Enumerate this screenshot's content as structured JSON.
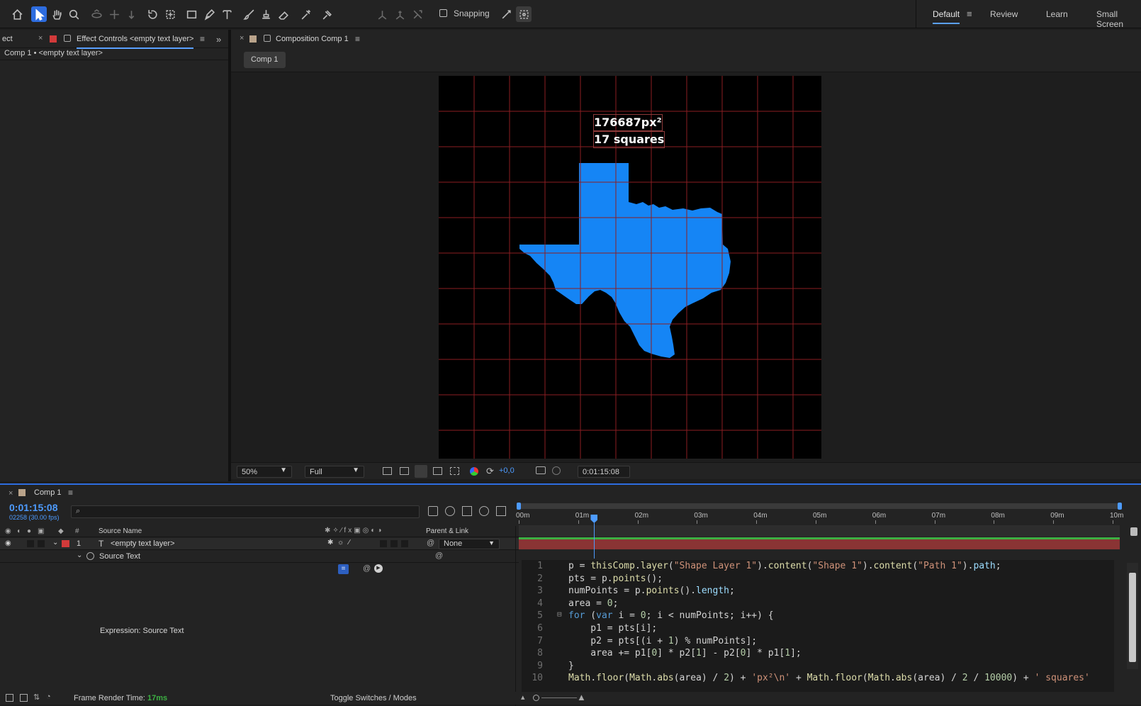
{
  "toolbar": {
    "snapping_label": "Snapping",
    "workspaces": [
      "Default",
      "Review",
      "Learn",
      "Small Screen"
    ],
    "active_workspace": "Default"
  },
  "effect_panel": {
    "partial_tab": "ect",
    "tab_label": "Effect Controls <empty text layer>",
    "subtitle": "Comp 1 • <empty text layer>"
  },
  "composition_panel": {
    "tab_label": "Composition Comp 1",
    "flow_button": "Comp 1",
    "overlay_line1": "176687px²",
    "overlay_line2": "17 squares",
    "shape_color": "#1585f5",
    "grid_color": "#8b1e22"
  },
  "viewer_bar": {
    "zoom": "50%",
    "resolution": "Full",
    "exposure": "+0,0",
    "timecode": "0:01:15:08"
  },
  "timeline": {
    "tab_label": "Comp 1",
    "timecode": "0:01:15:08",
    "frame_info": "02258 (30.00 fps)",
    "search_placeholder": "",
    "col_source_name": "Source Name",
    "col_number": "#",
    "col_parent": "Parent & Link",
    "layer_number": "1",
    "layer_type": "T",
    "layer_name": "<empty text layer>",
    "parent_value": "None",
    "property_name": "Source Text",
    "expression_label": "Expression: Source Text",
    "ruler_ticks": [
      "00m",
      "01m",
      "02m",
      "03m",
      "04m",
      "05m",
      "06m",
      "07m",
      "08m",
      "09m",
      "10m"
    ],
    "playhead_fraction": 0.1255
  },
  "code_lines": [
    {
      "n": "1",
      "t": "p = thisComp.layer(\"Shape Layer 1\").content(\"Shape 1\").content(\"Path 1\").path;"
    },
    {
      "n": "2",
      "t": "pts = p.points();"
    },
    {
      "n": "3",
      "t": "numPoints = p.points().length;"
    },
    {
      "n": "4",
      "t": "area = 0;"
    },
    {
      "n": "5",
      "t": "for (var i = 0; i < numPoints; i++) {"
    },
    {
      "n": "6",
      "t": "    p1 = pts[i];"
    },
    {
      "n": "7",
      "t": "    p2 = pts[(i + 1) % numPoints];"
    },
    {
      "n": "8",
      "t": "    area += p1[0] * p2[1] - p2[0] * p1[1];"
    },
    {
      "n": "9",
      "t": "}"
    },
    {
      "n": "10",
      "t": "Math.floor(Math.abs(area) / 2) + 'px²\\n' + Math.floor(Math.abs(area) / 2 / 10000) + ' squares'"
    }
  ],
  "status": {
    "render_label": "Frame Render Time:",
    "render_value": "17ms",
    "toggle_label": "Toggle Switches / Modes"
  }
}
